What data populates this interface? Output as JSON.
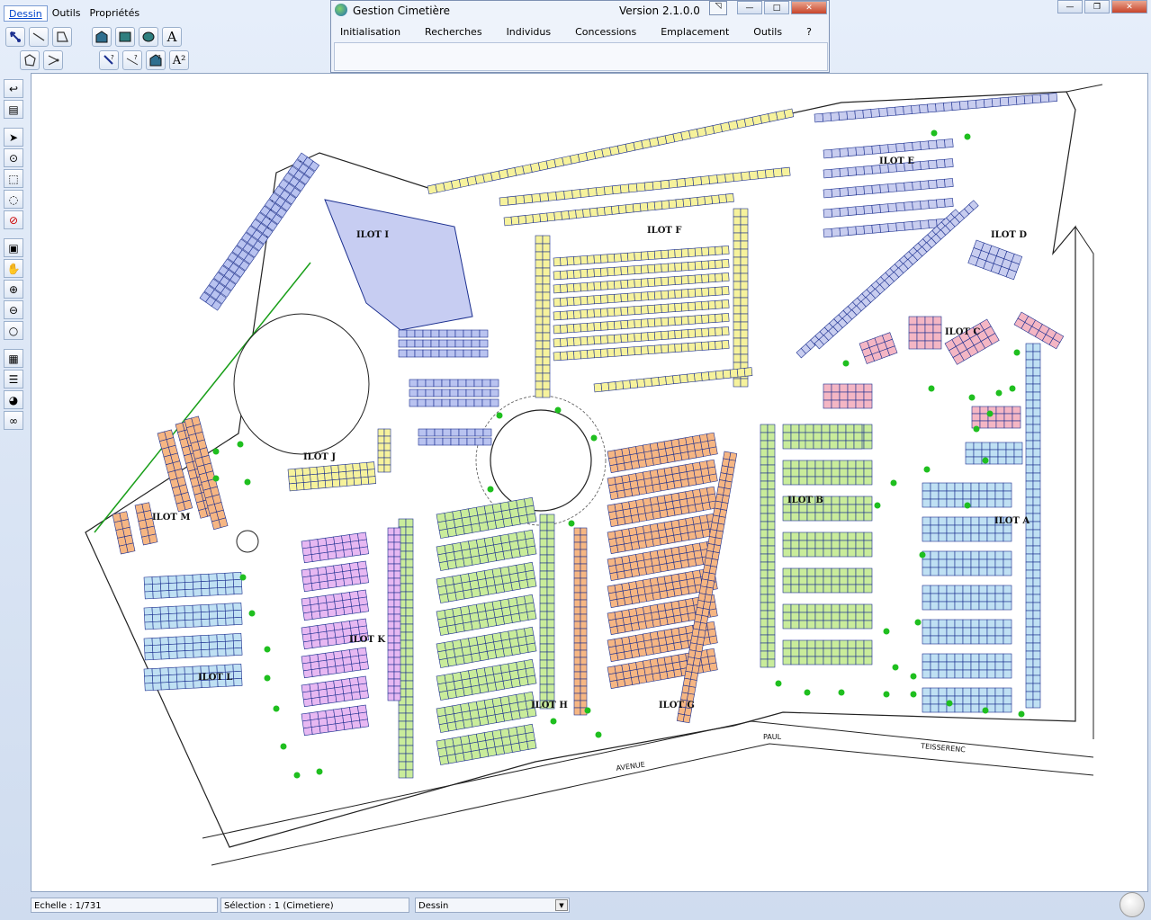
{
  "app": {
    "menu": [
      {
        "label": "Dessin",
        "active": true
      },
      {
        "label": "Outils",
        "active": false
      },
      {
        "label": "Propriétés",
        "active": false
      }
    ],
    "toolbar_row1_icons": [
      "select-point-icon",
      "line-icon",
      "polyline-icon",
      "house-icon",
      "rectangle-icon",
      "ellipse-icon",
      "text-icon"
    ],
    "toolbar_row2_icons": [
      "polygon-icon",
      "move-vertex-icon",
      "point-query-icon",
      "line-query-icon",
      "house-query-icon",
      "text-query-icon"
    ],
    "text_tool_glyph": "A",
    "text_query_glyph": "A²",
    "window_controls": [
      "minimize",
      "maximize",
      "close"
    ]
  },
  "dialog": {
    "title": "Gestion Cimetière",
    "version": "Version 2.1.0.0",
    "menu": [
      "Initialisation",
      "Recherches",
      "Individus",
      "Concessions",
      "Emplacement",
      "Outils",
      "?"
    ]
  },
  "left_toolbar_icons": [
    "back-icon",
    "layers-icon",
    "arrow-select-icon",
    "point-select-icon",
    "rect-select-icon",
    "lasso-select-icon",
    "no-select-icon",
    "zoom-extent-icon",
    "pan-hand-icon",
    "zoom-in-icon",
    "zoom-out-icon",
    "magnifier-icon",
    "report-icon",
    "list-icon",
    "palette-icon",
    "link-icon"
  ],
  "map": {
    "ilots": [
      "ILOT A",
      "ILOT B",
      "ILOT C",
      "ILOT D",
      "ILOT E",
      "ILOT F",
      "ILOT G",
      "ILOT H",
      "ILOT I",
      "ILOT J",
      "ILOT K",
      "ILOT L",
      "ILOT M"
    ],
    "streets": [
      "PAUL",
      "TEISSERENC",
      "AVENUE"
    ],
    "colors": {
      "A": "#bfe0f3",
      "B": "#c9ec9b",
      "C": "#f4b6c4",
      "D": "#b9c3f0",
      "E": "#c8cdef",
      "F": "#f6f29c",
      "G": "#f6b683",
      "H": "#c9ec9b",
      "I": "#b9c3f0",
      "J": "#f6f29c",
      "K": "#e7b8f2",
      "L": "#bfe0f3",
      "M": "#f6b683",
      "outline": "#1b2f8f",
      "tree": "#1fbf1f"
    }
  },
  "status": {
    "scale": "Echelle : 1/731",
    "selection": "Sélection : 1 (Cimetiere)",
    "mode": "Dessin"
  }
}
